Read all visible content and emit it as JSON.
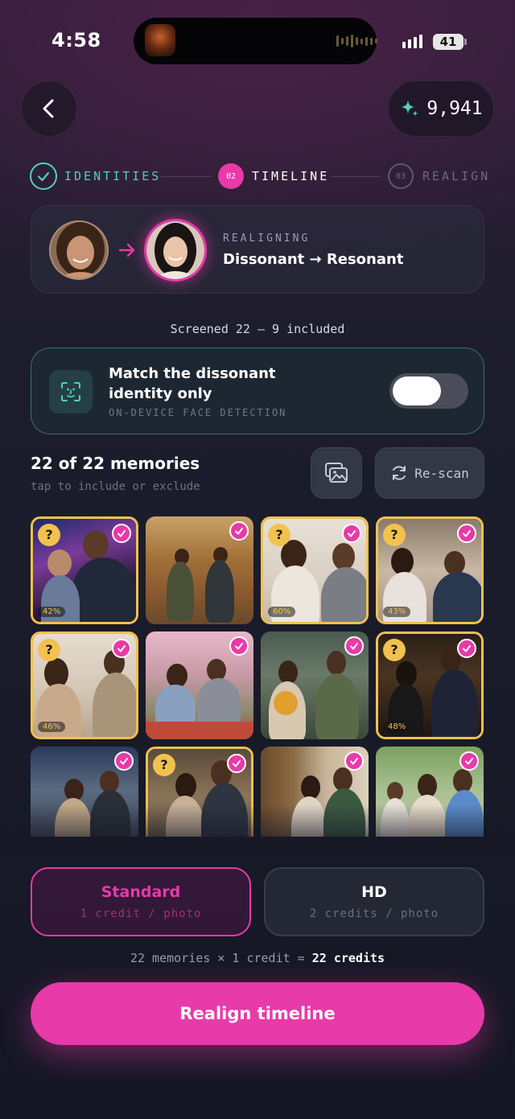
{
  "status_bar": {
    "time": "4:58",
    "battery": "41"
  },
  "header": {
    "credits": "9,941"
  },
  "steps": [
    {
      "label": "IDENTITIES",
      "state": "done"
    },
    {
      "number": "02",
      "label": "TIMELINE",
      "state": "active"
    },
    {
      "number": "03",
      "label": "REALIGN",
      "state": "pending"
    }
  ],
  "realign_card": {
    "eyebrow": "REALIGNING",
    "title": "Dissonant → Resonant"
  },
  "screened": "Screened 22 — 9 included",
  "match_card": {
    "title_line1": "Match the dissonant",
    "title_line2": "identity only",
    "subtitle": "ON-DEVICE FACE DETECTION",
    "toggle_on": false
  },
  "memories": {
    "count_label": "22 of 22 memories",
    "hint": "tap to include or exclude",
    "rescan_label": "Re-scan"
  },
  "photos": [
    {
      "flag": "?",
      "confidence": "42%",
      "selected": true
    },
    {
      "selected": true
    },
    {
      "flag": "?",
      "confidence": "60%",
      "selected": true
    },
    {
      "flag": "?",
      "confidence": "43%",
      "selected": true
    },
    {
      "flag": "?",
      "confidence": "46%",
      "selected": true
    },
    {
      "selected": true
    },
    {
      "selected": true
    },
    {
      "flag": "?",
      "confidence": "48%",
      "selected": true
    },
    {
      "selected": true
    },
    {
      "flag": "?",
      "selected": true
    },
    {
      "selected": true
    },
    {
      "selected": true
    }
  ],
  "quality": {
    "standard": {
      "title": "Standard",
      "sub": "1 credit / photo",
      "selected": true
    },
    "hd": {
      "title": "HD",
      "sub": "2 credits / photo",
      "selected": false
    }
  },
  "summary": {
    "prefix": "22 memories × 1 credit =",
    "total": "22 credits"
  },
  "cta": "Realign timeline",
  "colors": {
    "accent": "#e83aa8",
    "teal": "#4fd1b8",
    "flag": "#f2c14e"
  },
  "icons": [
    "back-arrow-icon",
    "sparkle-icon",
    "check-icon",
    "arrow-right-icon",
    "face-scan-icon",
    "gallery-icon",
    "refresh-icon"
  ]
}
